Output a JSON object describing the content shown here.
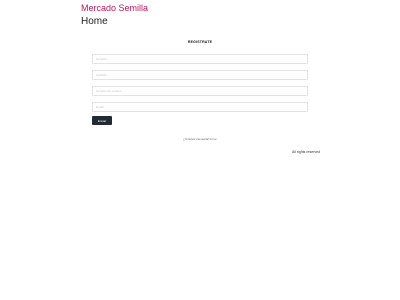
{
  "header": {
    "brand": "Mercado Semilla",
    "page_title": "Home"
  },
  "form": {
    "heading": "REGISTRATE",
    "fields": [
      {
        "placeholder": "Nombre"
      },
      {
        "placeholder": "Apellido"
      },
      {
        "placeholder": "Nombre de usuario"
      },
      {
        "placeholder": "Email"
      }
    ],
    "submit_label": "Enviar"
  },
  "login": {
    "prompt": "¿Ya tienes una cuenta?",
    "link": "Entrar"
  },
  "footer": {
    "text": "All rights reserved"
  },
  "colors": {
    "brand": "#c2185b",
    "button": "#222a33"
  }
}
